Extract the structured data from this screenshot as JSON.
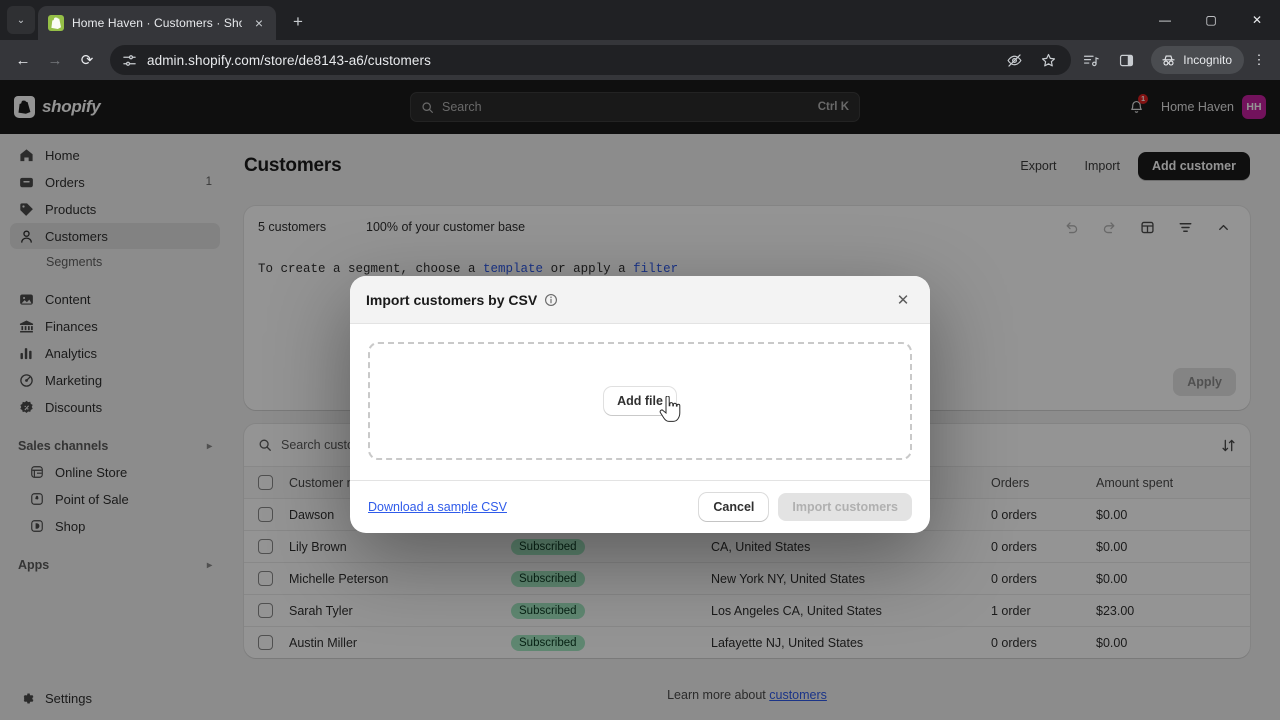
{
  "browser": {
    "tab": {
      "title": "Home Haven · Customers · Sho",
      "favicon": "shopify-favicon",
      "close_label": "×"
    },
    "newtab_label": "+",
    "chevron_label": "⌄",
    "window": {
      "minimize": "—",
      "maximize": "▢",
      "close": "✕"
    },
    "nav": {
      "back": "←",
      "forward": "→",
      "reload": "⟳"
    },
    "omnibox": {
      "url": "admin.shopify.com/store/de8143-a6/customers",
      "site_settings_icon": "tune-icon"
    },
    "toolbar_icons": [
      "eye-off-icon",
      "star-icon",
      "reading-list-icon",
      "side-panel-icon"
    ],
    "incognito_label": "Incognito",
    "menu_label": "⋮"
  },
  "topbar": {
    "logo_text": "shopify",
    "search": {
      "placeholder": "Search",
      "shortcut": "Ctrl K"
    },
    "notifications": {
      "count": "1"
    },
    "store": {
      "name": "Home Haven",
      "initials": "HH"
    }
  },
  "sidebar": {
    "items": [
      {
        "label": "Home",
        "icon": "home-icon",
        "badge": ""
      },
      {
        "label": "Orders",
        "icon": "orders-icon",
        "badge": "1"
      },
      {
        "label": "Products",
        "icon": "products-icon",
        "badge": ""
      },
      {
        "label": "Customers",
        "icon": "customers-icon",
        "badge": "",
        "active": true
      },
      {
        "label": "Content",
        "icon": "content-icon",
        "badge": ""
      },
      {
        "label": "Finances",
        "icon": "finances-icon",
        "badge": ""
      },
      {
        "label": "Analytics",
        "icon": "analytics-icon",
        "badge": ""
      },
      {
        "label": "Marketing",
        "icon": "marketing-icon",
        "badge": ""
      },
      {
        "label": "Discounts",
        "icon": "discounts-icon",
        "badge": ""
      }
    ],
    "sub_item": "Segments",
    "sales_channels": {
      "title": "Sales channels",
      "items": [
        {
          "label": "Online Store",
          "icon": "online-store-icon"
        },
        {
          "label": "Point of Sale",
          "icon": "point-of-sale-icon"
        },
        {
          "label": "Shop",
          "icon": "shop-icon"
        }
      ]
    },
    "apps": {
      "title": "Apps"
    },
    "settings": {
      "label": "Settings",
      "icon": "gear-icon"
    }
  },
  "main": {
    "title": "Customers",
    "actions": {
      "export": "Export",
      "import": "Import",
      "add_customer": "Add customer"
    },
    "segment": {
      "count": "5 customers",
      "percent": "100% of your customer base",
      "hint_prefix": "To create a segment, choose a ",
      "hint_link1": "template",
      "hint_mid": " or apply a ",
      "hint_link2": "filter",
      "apply_label": "Apply",
      "tools": [
        "undo-icon",
        "redo-icon",
        "columns-icon",
        "filter-icon",
        "collapse-icon"
      ]
    },
    "table": {
      "search_placeholder": "Search customers",
      "sort_icon": "sort-icon",
      "columns": [
        "Customer name",
        "",
        "",
        "Orders",
        "Amount spent"
      ],
      "rows": [
        {
          "name": "Dawson",
          "subscription": "",
          "location": "",
          "orders": "0 orders",
          "amount": "$0.00"
        },
        {
          "name": "Lily Brown",
          "subscription": "Subscribed",
          "location": "CA, United States",
          "orders": "0 orders",
          "amount": "$0.00"
        },
        {
          "name": "Michelle Peterson",
          "subscription": "Subscribed",
          "location": "New York NY, United States",
          "orders": "0 orders",
          "amount": "$0.00"
        },
        {
          "name": "Sarah Tyler",
          "subscription": "Subscribed",
          "location": "Los Angeles CA, United States",
          "orders": "1 order",
          "amount": "$23.00"
        },
        {
          "name": "Austin Miller",
          "subscription": "Subscribed",
          "location": "Lafayette NJ, United States",
          "orders": "0 orders",
          "amount": "$0.00"
        }
      ]
    },
    "footer": {
      "learn_prefix": "Learn more about ",
      "learn_link": "customers"
    }
  },
  "modal": {
    "title": "Import customers by CSV",
    "info_icon": "info-icon",
    "close_label": "✕",
    "add_file_label": "Add file",
    "sample_link": "Download a sample CSV",
    "cancel_label": "Cancel",
    "import_label": "Import customers"
  },
  "colors": {
    "accent_link": "#2f5bea",
    "primary_button": "#1a1a1a",
    "badge_bg": "#a4e8c3",
    "avatar_bg": "#c4209f",
    "notification_badge": "#e02020"
  }
}
